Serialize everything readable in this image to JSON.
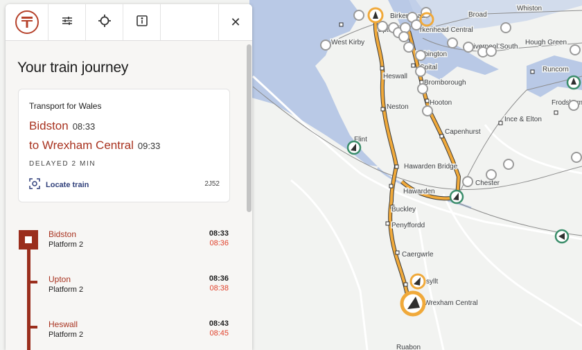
{
  "map": {
    "places": [
      "Birkenhead",
      "Broad Green",
      "Whiston",
      "West Kirby",
      "Birkenhead Central",
      "Upton",
      "Liverpool South",
      "Hough Green",
      "Bebington",
      "Spital",
      "Runcorn",
      "Bromborough",
      "Heswall",
      "Neston",
      "Hooton",
      "Frodsham",
      "Capenhurst",
      "Ince & Elton",
      "Flint",
      "Hawarden Bridge",
      "Hawarden",
      "Chester",
      "Buckley",
      "Penyffordd",
      "Caergwrle",
      "Gwersyllt",
      "Wrexham Central",
      "Ruabon"
    ],
    "visible_places": [
      "Birkenhead",
      "Broad",
      "Whiston",
      "West Kirby",
      "rkenhead Central",
      "Upton",
      "Liverpool South",
      "Hough Green",
      "Bebington",
      "Spital",
      "Runcorn",
      "Bromborough",
      "Heswall",
      "Neston",
      "Hooton",
      "Frodsham",
      "Capenhurst",
      "Ince & Elton",
      "Flint",
      "Hawarden Bridge",
      "Hawarden",
      "Chester",
      "Buckley",
      "Penyffordd",
      "Caergwrle",
      "syllt",
      "Wrexham Central",
      "Ruabon"
    ],
    "route_color": "#f0a93a",
    "active_train_color": "#f0a93a",
    "other_train_color_green": "#3a8d6a",
    "other_train_color_grey": "#9a9a9a"
  },
  "toolbar": {
    "logo": "T",
    "filters_icon": "sliders-icon",
    "locate_icon": "crosshair-icon",
    "info_icon": "info-icon",
    "close_label": "✕"
  },
  "journey": {
    "heading": "Your train journey",
    "operator": "Transport for Wales",
    "from_station": "Bidston",
    "from_time": "08:33",
    "to_station": "to Wrexham Central",
    "to_time": "09:33",
    "status": "DELAYED 2 MIN",
    "locate_label": "Locate train",
    "train_code": "2J52"
  },
  "stops": [
    {
      "name": "Bidston",
      "platform": "Platform 2",
      "scheduled": "08:33",
      "expected": "08:36"
    },
    {
      "name": "Upton",
      "platform": "Platform 2",
      "scheduled": "08:36",
      "expected": "08:38"
    },
    {
      "name": "Heswall",
      "platform": "Platform 2",
      "scheduled": "08:43",
      "expected": "08:45"
    }
  ],
  "colors": {
    "brand_red": "#a8321f",
    "late_red": "#e0412b",
    "locate_blue": "#2f3f7a"
  }
}
